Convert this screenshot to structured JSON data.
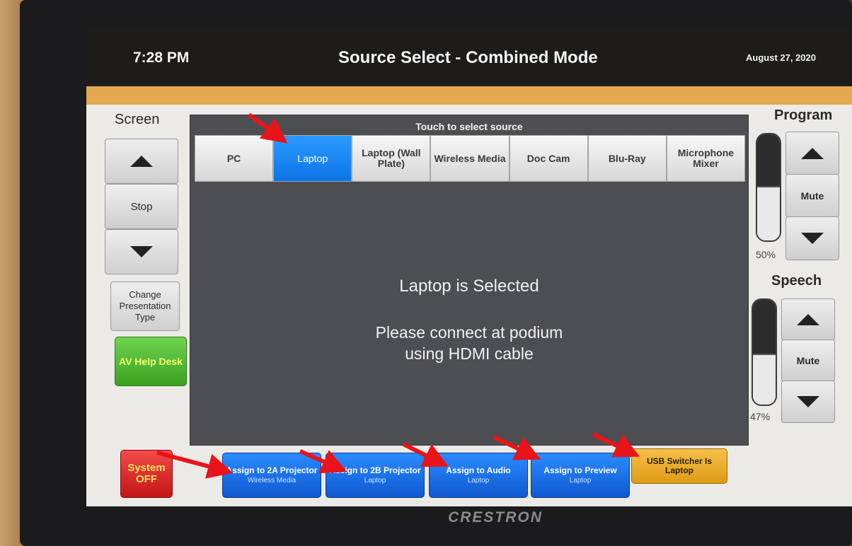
{
  "header": {
    "time": "7:28 PM",
    "title": "Source Select - Combined Mode",
    "date": "August 27, 2020"
  },
  "left_panel": {
    "heading": "Screen",
    "stop_label": "Stop",
    "change_presentation_label": "Change Presentation Type",
    "help_desk_label": "AV Help Desk",
    "system_off_label": "System OFF"
  },
  "sources": {
    "prompt": "Touch to select source",
    "items": [
      {
        "label": "PC",
        "active": false
      },
      {
        "label": "Laptop",
        "active": true
      },
      {
        "label": "Laptop (Wall Plate)",
        "active": false
      },
      {
        "label": "Wireless Media",
        "active": false
      },
      {
        "label": "Doc Cam",
        "active": false
      },
      {
        "label": "Blu-Ray",
        "active": false
      },
      {
        "label": "Microphone Mixer",
        "active": false
      }
    ]
  },
  "status": {
    "line1": "Laptop is Selected",
    "line2a": "Please connect at podium",
    "line2b": "using HDMI cable"
  },
  "program": {
    "heading": "Program",
    "mute_label": "Mute",
    "level_text": "50%",
    "level": 0.5
  },
  "speech": {
    "heading": "Speech",
    "mute_label": "Mute",
    "level_text": "47%",
    "level": 0.47
  },
  "assign": {
    "a2": {
      "label": "Assign to 2A Projector",
      "sub": "Wireless Media"
    },
    "b2": {
      "label": "Assign to 2B Projector",
      "sub": "Laptop"
    },
    "audio": {
      "label": "Assign to Audio",
      "sub": "Laptop"
    },
    "preview": {
      "label": "Assign to Preview",
      "sub": "Laptop"
    },
    "usb": {
      "label": "USB Switcher Is Laptop"
    }
  },
  "device_brand": "CRESTRON",
  "colors": {
    "accent_bar": "#e2a94f",
    "active_source": "#0d73e8",
    "assign_blue": "#0f58d0",
    "help_desk_green": "#3aa21e",
    "system_off_red": "#c41515",
    "usb_yellow": "#df9b15",
    "annotation_arrow": "#e8141a"
  }
}
